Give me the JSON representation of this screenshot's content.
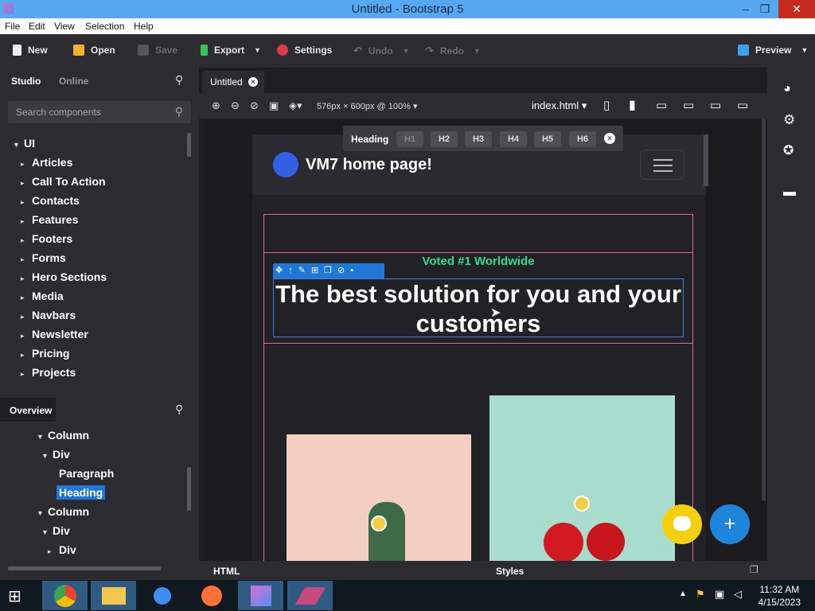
{
  "window": {
    "title": "Untitled - Bootstrap 5"
  },
  "menu": [
    "File",
    "Edit",
    "View",
    "Selection",
    "Help"
  ],
  "toolbar": {
    "new": "New",
    "open": "Open",
    "save": "Save",
    "export": "Export",
    "settings": "Settings",
    "undo": "Undo",
    "redo": "Redo",
    "preview": "Preview"
  },
  "left": {
    "tab_studio": "Studio",
    "tab_online": "Online",
    "search_placeholder": "Search components",
    "root": "UI",
    "items": [
      "Articles",
      "Call To Action",
      "Contacts",
      "Features",
      "Footers",
      "Forms",
      "Hero Sections",
      "Media",
      "Navbars",
      "Newsletter",
      "Pricing",
      "Projects"
    ]
  },
  "overview": {
    "title": "Overview",
    "nodes": [
      "Column",
      "Div",
      "Paragraph",
      "Heading",
      "Column",
      "Div",
      "Div"
    ]
  },
  "canvas": {
    "tab": "Untitled",
    "size": "576px × 600px @ 100%",
    "file": "index.html",
    "heading_label": "Heading",
    "heading_levels": [
      "H1",
      "H2",
      "H3",
      "H4",
      "H5",
      "H6"
    ],
    "brand": "VM7 home page!",
    "voted": "Voted #1 Worldwide",
    "headline": "The best solution for you and your customers"
  },
  "bottom": {
    "html": "HTML",
    "styles": "Styles"
  },
  "taskbar": {
    "time": "11:32 AM",
    "date": "4/15/2023"
  },
  "colors": {
    "accent": "#1f77d8",
    "green": "#2fde8a",
    "pink": "#d86aa3"
  }
}
